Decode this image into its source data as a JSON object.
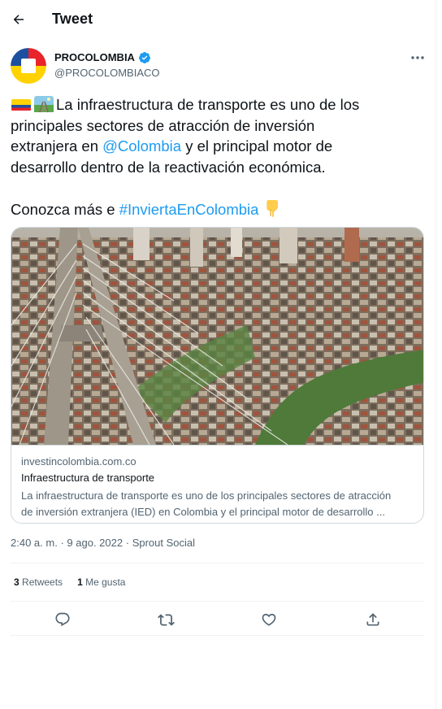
{
  "header": {
    "title": "Tweet",
    "back_icon": "arrow-left-icon"
  },
  "author": {
    "name": "PROCOLOMBIA",
    "handle": "@PROCOLOMBIACO",
    "verified": true,
    "avatar_colors": [
      "#1d4fa1",
      "#e8232a",
      "#ffd200"
    ]
  },
  "tweet": {
    "line1_text": "La infraestructura de transporte  es uno de los",
    "line2": "principales sectores de atracción de inversión",
    "line3_pre": "extranjera en ",
    "mention": "@Colombia",
    "line3_post": " y el principal motor de",
    "line4": "desarrollo dentro de la reactivación económica.",
    "cta_pre": "Conozca más e ",
    "hashtag": "#InviertaEnColombia",
    "emojis": [
      "colombia-flag-emoji",
      "railway-track-emoji",
      "pointing-down-emoji"
    ]
  },
  "card": {
    "domain": "investincolombia.com.co",
    "title": "Infraestructura de transporte",
    "desc_line1": "La infraestructura de transporte es uno de los principales sectores de atracción",
    "desc_line2": "de inversión extranjera (IED) en Colombia y el principal motor de desarrollo ..."
  },
  "meta": {
    "time": "2:40 a. m.",
    "sep": "·",
    "date": "9 ago. 2022",
    "source": "Sprout Social"
  },
  "stats": {
    "retweets_count": "3",
    "retweets_label": "Retweets",
    "likes_count": "1",
    "likes_label": "Me gusta"
  },
  "actions": [
    "reply-icon",
    "retweet-icon",
    "like-icon",
    "share-icon"
  ],
  "colors": {
    "link": "#1d9bf0",
    "muted": "#536471",
    "border": "#cfd9de",
    "text": "#0f1419"
  }
}
